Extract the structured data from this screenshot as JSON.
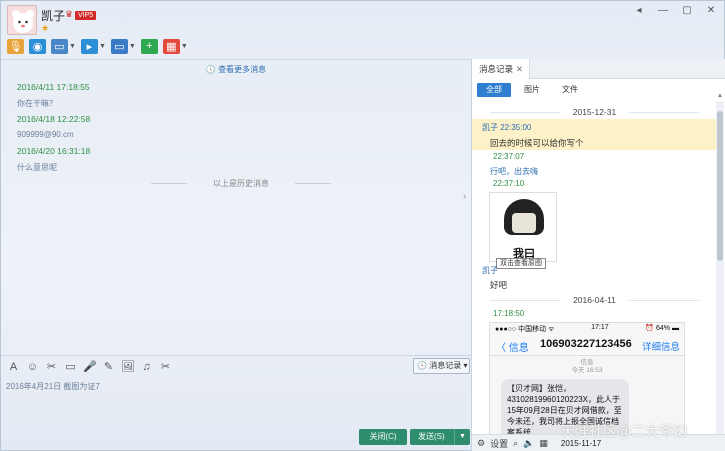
{
  "contact": {
    "name": "凯子",
    "vip": "VIP5",
    "star": "★"
  },
  "window_buttons": [
    "◂",
    "—",
    "▢",
    "✕"
  ],
  "toolbar": [
    {
      "name": "voice-call-icon",
      "glyph": "🎙",
      "color": "#e8a33a"
    },
    {
      "name": "video-call-icon",
      "glyph": "◉",
      "color": "#2b8fd8"
    },
    {
      "name": "remote-desktop-icon",
      "glyph": "▭",
      "color": "#4b86c6"
    },
    {
      "name": "send-file-icon",
      "glyph": "▸",
      "color": "#2d8fd6"
    },
    {
      "name": "screen-share-icon",
      "glyph": "▭",
      "color": "#3a7bc8"
    },
    {
      "name": "create-group-icon",
      "glyph": "+",
      "color": "#2fa84f"
    },
    {
      "name": "apps-icon",
      "glyph": "▦",
      "color": "#e24a3b"
    }
  ],
  "chat": {
    "more_link": "查看更多消息",
    "messages": [
      {
        "time": "2016/4/11 17:18:55",
        "text": "你在干嘛？"
      },
      {
        "time": "2016/4/18 12:22:58",
        "text": "909999@90.cm"
      },
      {
        "time": "2016/4/20 16:31:18",
        "text": "什么意思呢"
      }
    ],
    "history_divider": "以上是历史消息"
  },
  "input": {
    "toolbar_glyphs": [
      "A",
      "☺",
      "✂",
      "▭",
      "🎤",
      "✎",
      "🖼",
      "♫",
      "✂"
    ],
    "history_button": "消息记录",
    "draft": "2016年4月21日 截图为证7",
    "close_button": "关闭(C)",
    "send_button": "发送(S)"
  },
  "record_panel": {
    "tab": "消息记录",
    "filters": [
      "全部",
      "图片",
      "文件"
    ],
    "entries": {
      "date1": "2015-12-31",
      "name1": "凯子 22:35:00",
      "msg1": "回去的时候可以给你写个",
      "time2": "22:37:07",
      "msg2": "行吧，出去嗨",
      "time3": "22:37:10",
      "sticker_text": "我曰",
      "tooltip": "双击查看原图",
      "name4": "凯子",
      "msg4": "好吧",
      "date2": "2016-04-11",
      "time5": "17:18:50"
    },
    "phone": {
      "carrier": "●●●○○ 中国移动 ᯤ",
      "clock": "17:17",
      "battery": "⏰ 64% ▬",
      "back": "〈 信息",
      "sender": "106903227123456",
      "details": "详细信息",
      "sub1": "信息",
      "sub2": "今天 16:53",
      "sms": "【贝才网】张恺，431028199601202​23X，此人于15年09月28日在贝才网借款，至今未还，我司将上报全国诚信档案系统"
    },
    "bottom": {
      "settings": "设置",
      "date": "2015-11-17"
    }
  },
  "watermark": "天涯社区@二大爷幻"
}
